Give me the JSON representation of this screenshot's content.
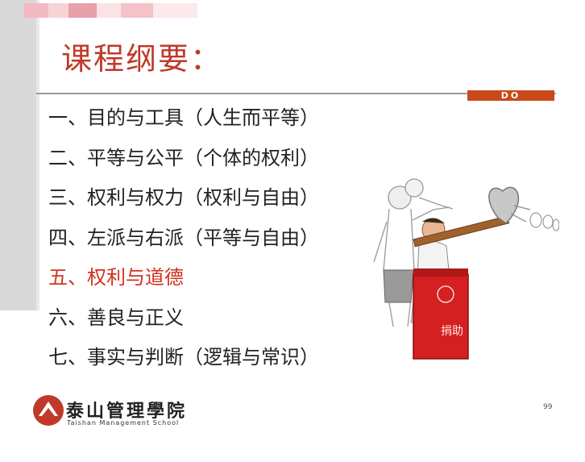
{
  "slide": {
    "title": "课程纲要：",
    "tag": "DO",
    "items": [
      {
        "text": "一、目的与工具（人生而平等）"
      },
      {
        "text": "二、平等与公平（个体的权利）"
      },
      {
        "text": "三、权利与权力（权利与自由）"
      },
      {
        "text": "四、左派与右派（平等与自由）"
      },
      {
        "text": "五、权利与道德"
      },
      {
        "text": "六、善良与正义"
      },
      {
        "text": "七、事实与判断（逻辑与常识）"
      }
    ],
    "highlighted_item_index": 4,
    "illustration_label": "捐助",
    "logo_name": "泰山管理學院",
    "logo_subtitle": "Taishan Management School",
    "page_number": "99"
  },
  "colors": {
    "title": "#c0392b",
    "highlight": "#d0321f",
    "tag_bg": "#c9491b",
    "text": "#222222",
    "left_band": "#d9d9d9"
  }
}
